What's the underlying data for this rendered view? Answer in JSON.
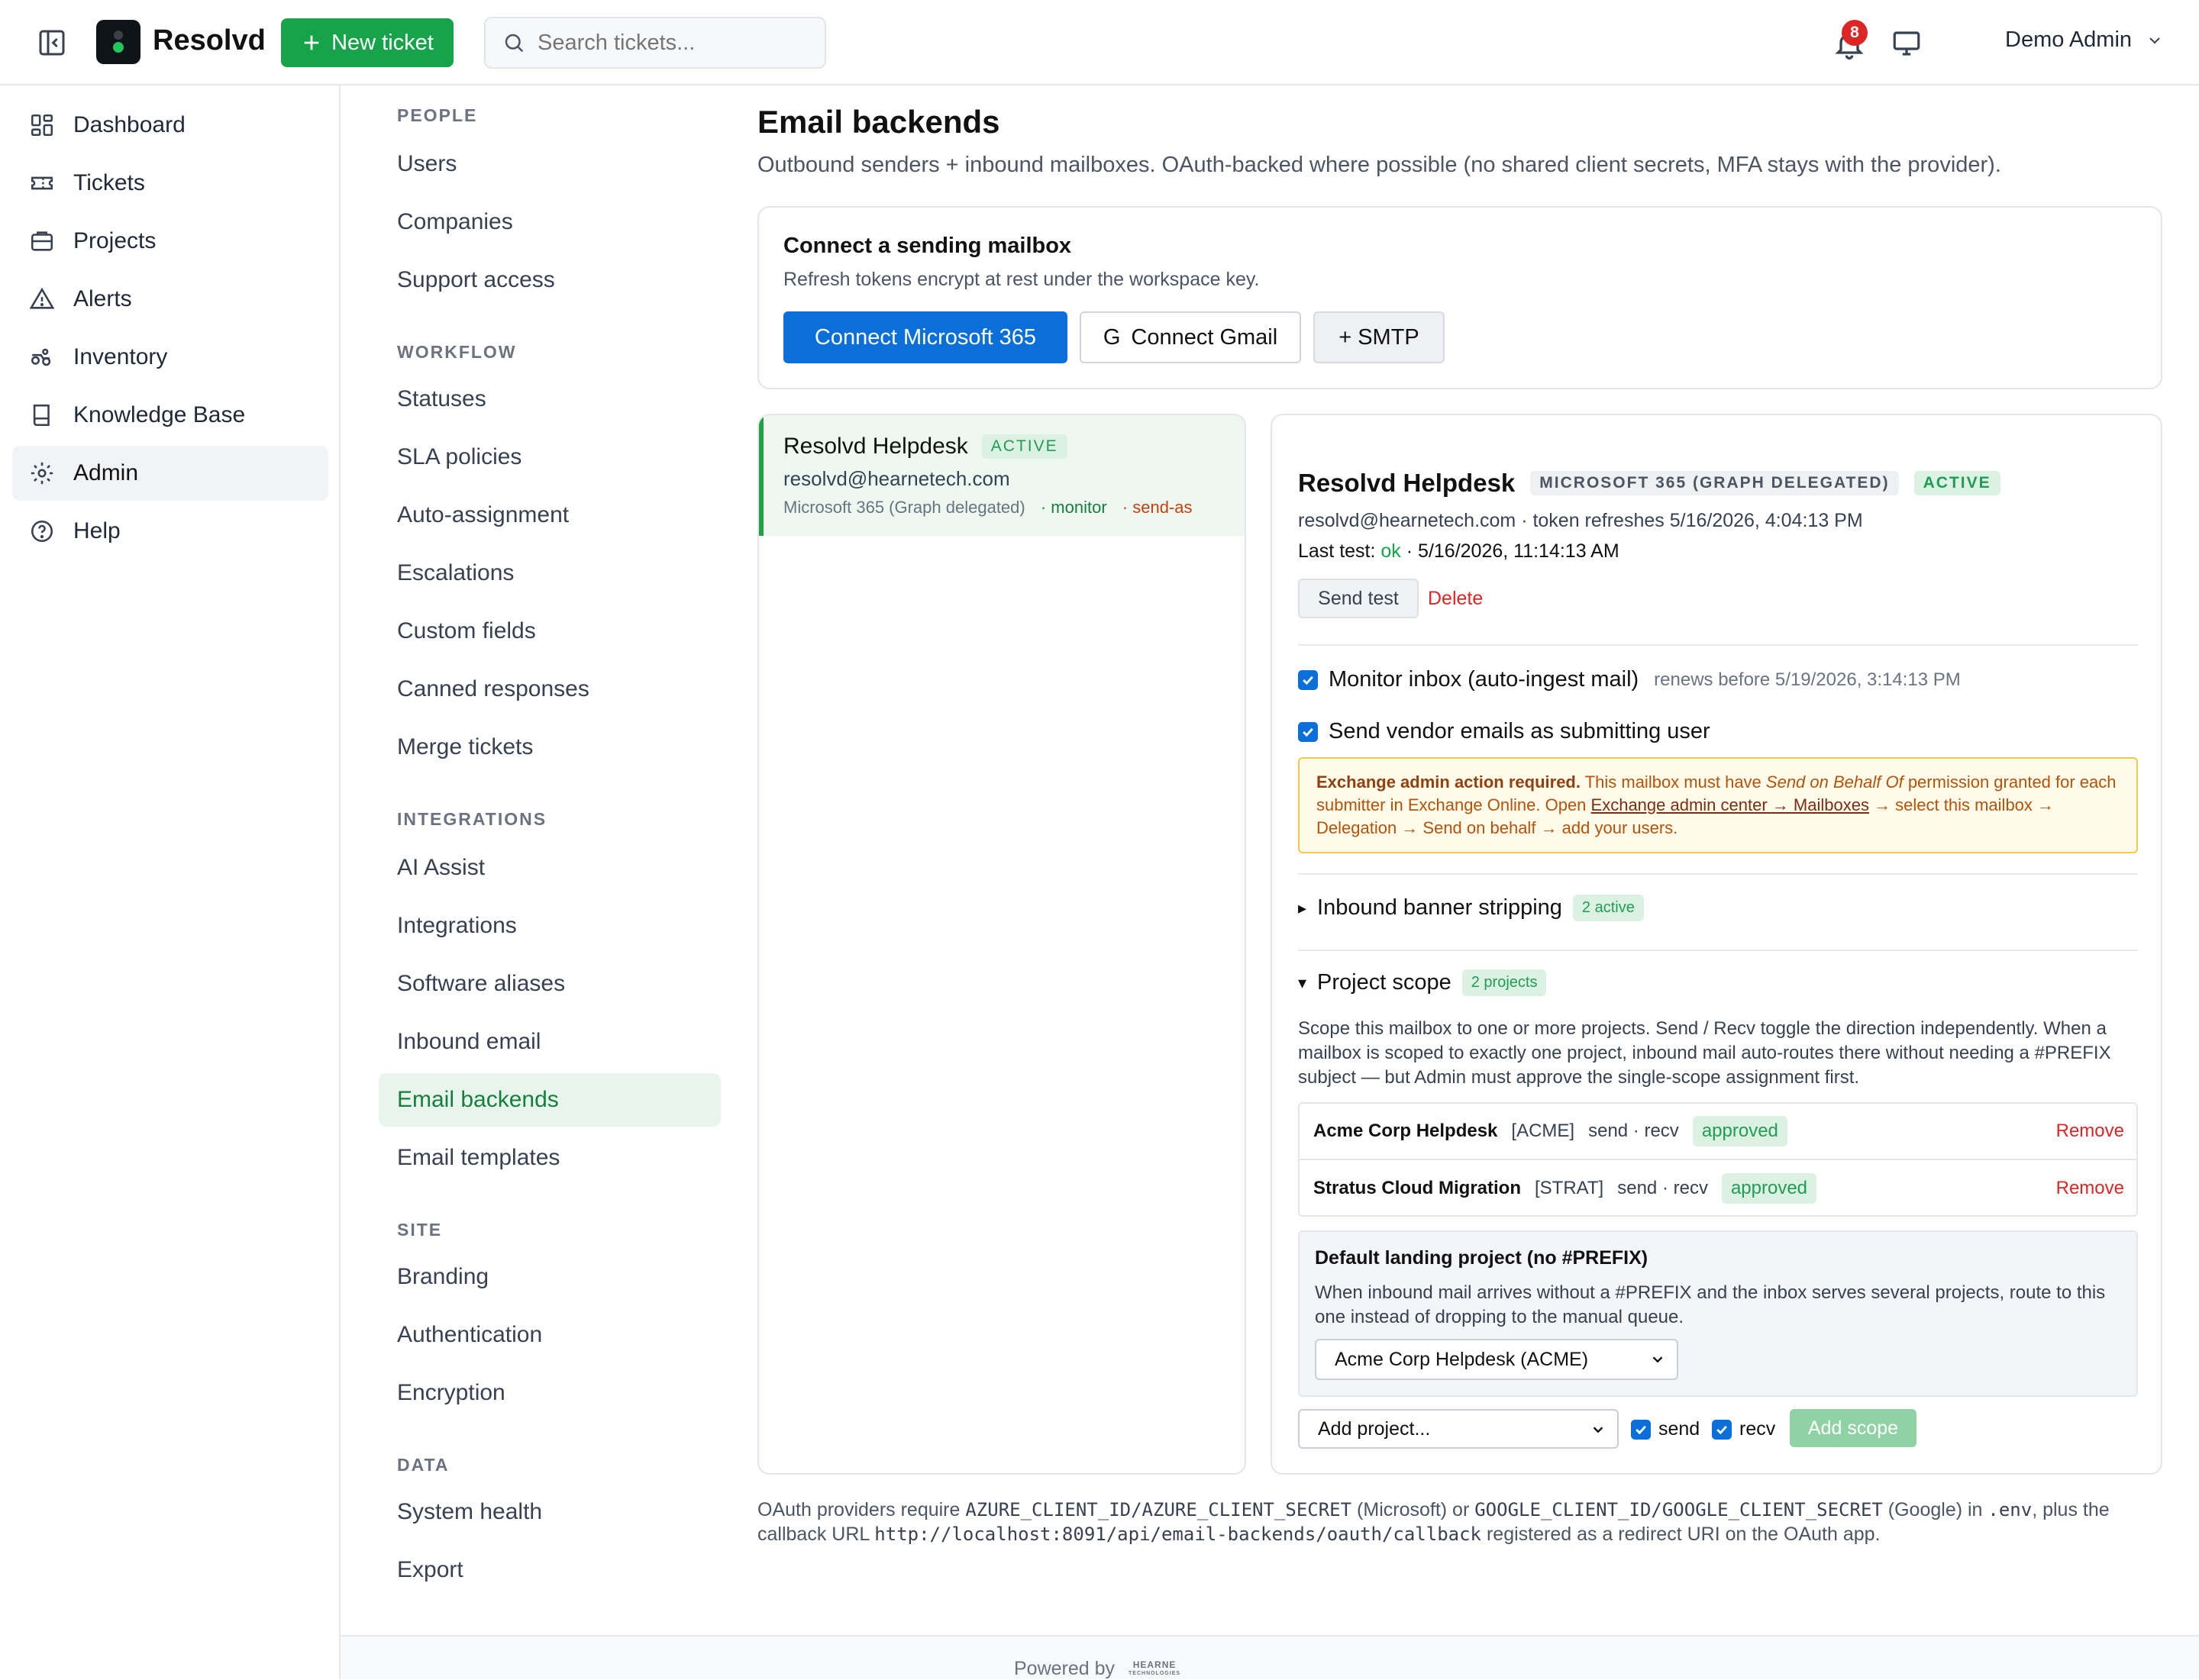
{
  "app": {
    "brand": "Resolvd",
    "new_ticket": "New ticket",
    "search_placeholder": "Search tickets...",
    "notifications": "8",
    "user": "Demo Admin"
  },
  "nav": [
    {
      "label": "Dashboard",
      "icon": "dashboard-icon"
    },
    {
      "label": "Tickets",
      "icon": "ticket-icon"
    },
    {
      "label": "Projects",
      "icon": "projects-icon"
    },
    {
      "label": "Alerts",
      "icon": "alert-icon"
    },
    {
      "label": "Inventory",
      "icon": "inventory-icon"
    },
    {
      "label": "Knowledge Base",
      "icon": "book-icon"
    },
    {
      "label": "Admin",
      "icon": "gear-icon",
      "active": true
    },
    {
      "label": "Help",
      "icon": "help-icon"
    }
  ],
  "admin": {
    "people": {
      "title": "PEOPLE",
      "items": [
        "Users",
        "Companies",
        "Support access"
      ]
    },
    "workflow": {
      "title": "WORKFLOW",
      "items": [
        "Statuses",
        "SLA policies",
        "Auto-assignment",
        "Escalations",
        "Custom fields",
        "Canned responses",
        "Merge tickets"
      ]
    },
    "integrations": {
      "title": "INTEGRATIONS",
      "items": [
        "AI Assist",
        "Integrations",
        "Software aliases",
        "Inbound email",
        "Email backends",
        "Email templates"
      ]
    },
    "site": {
      "title": "SITE",
      "items": [
        "Branding",
        "Authentication",
        "Encryption"
      ]
    },
    "data": {
      "title": "DATA",
      "items": [
        "System health",
        "Export"
      ]
    },
    "active": "Email backends"
  },
  "page": {
    "title": "Email backends",
    "subtitle": "Outbound senders + inbound mailboxes. OAuth-backed where possible (no shared client secrets, MFA stays with the provider)."
  },
  "connect": {
    "title": "Connect a sending mailbox",
    "subtitle": "Refresh tokens encrypt at rest under the workspace key.",
    "ms_button": "Connect Microsoft 365",
    "gmail_icon": "G",
    "gmail_button": "Connect Gmail",
    "smtp_button": "+ SMTP"
  },
  "mailbox_list": [
    {
      "name": "Resolvd Helpdesk",
      "status": "ACTIVE",
      "email": "resolvd@hearnetech.com",
      "provider": "Microsoft 365 (Graph delegated)",
      "monitor": "· monitor",
      "sendas": "· send-as"
    }
  ],
  "detail": {
    "name": "Resolvd Helpdesk",
    "provider_tag": "MICROSOFT 365 (GRAPH DELEGATED)",
    "status": "ACTIVE",
    "line1": "resolvd@hearnetech.com · token refreshes 5/16/2026, 4:04:13 PM",
    "last_test_label": "Last test:",
    "last_test_status": "ok",
    "last_test_time": "· 5/16/2026, 11:14:13 AM",
    "send_test": "Send test",
    "delete": "Delete",
    "monitor_label": "Monitor inbox (auto-ingest mail)",
    "monitor_note": "renews before 5/19/2026, 3:14:13 PM",
    "monitor_checked": true,
    "vendor_label": "Send vendor emails as submitting user",
    "vendor_checked": true,
    "warning": {
      "bold": "Exchange admin action required.",
      "t1": " This mailbox must have ",
      "em": "Send on Behalf Of",
      "t2": " permission granted for each submitter in Exchange Online. Open ",
      "link": "Exchange admin center → Mailboxes",
      "t3": " → select this mailbox → Delegation → Send on behalf → add your users."
    },
    "banner": {
      "label": "Inbound banner stripping",
      "count": "2 active",
      "arrow": "▸"
    },
    "scope": {
      "label": "Project scope",
      "count": "2 projects",
      "arrow": "▾",
      "description": "Scope this mailbox to one or more projects. Send / Recv toggle the direction independently. When a mailbox is scoped to exactly one project, inbound mail auto-routes there without needing a #PREFIX subject — but Admin must approve the single-scope assignment first.",
      "rows": [
        {
          "name": "Acme Corp Helpdesk",
          "code": "[ACME]",
          "dir": "send · recv",
          "status": "approved",
          "remove": "Remove"
        },
        {
          "name": "Stratus Cloud Migration",
          "code": "[STRAT]",
          "dir": "send · recv",
          "status": "approved",
          "remove": "Remove"
        }
      ],
      "landing_title": "Default landing project (no #PREFIX)",
      "landing_desc": "When inbound mail arrives without a #PREFIX and the inbox serves several projects, route to this one instead of dropping to the manual queue.",
      "landing_selected": "Acme Corp Helpdesk (ACME)",
      "add_placeholder": "Add project...",
      "send_label": "send",
      "recv_label": "recv",
      "add_button": "Add scope"
    }
  },
  "footer_note": {
    "t1": "OAuth providers require ",
    "c1": "AZURE_CLIENT_ID/AZURE_CLIENT_SECRET",
    "t2": " (Microsoft) or ",
    "c2": "GOOGLE_CLIENT_ID/GOOGLE_CLIENT_SECRET",
    "t3": " (Google) in ",
    "c3": ".env",
    "t4": ", plus the callback URL ",
    "c4": "http://localhost:8091/api/email-backends/oauth/callback",
    "t5": " registered as a redirect URI on the OAuth app."
  },
  "footer": {
    "powered": "Powered by",
    "logo_l1": "HEARNE",
    "logo_l2": "TECHNOLOGIES"
  },
  "colors": {
    "accent": "#16a34a",
    "primary_blue": "#0a6fd8",
    "danger": "#dc2626",
    "warning_border": "#f2c94c"
  }
}
